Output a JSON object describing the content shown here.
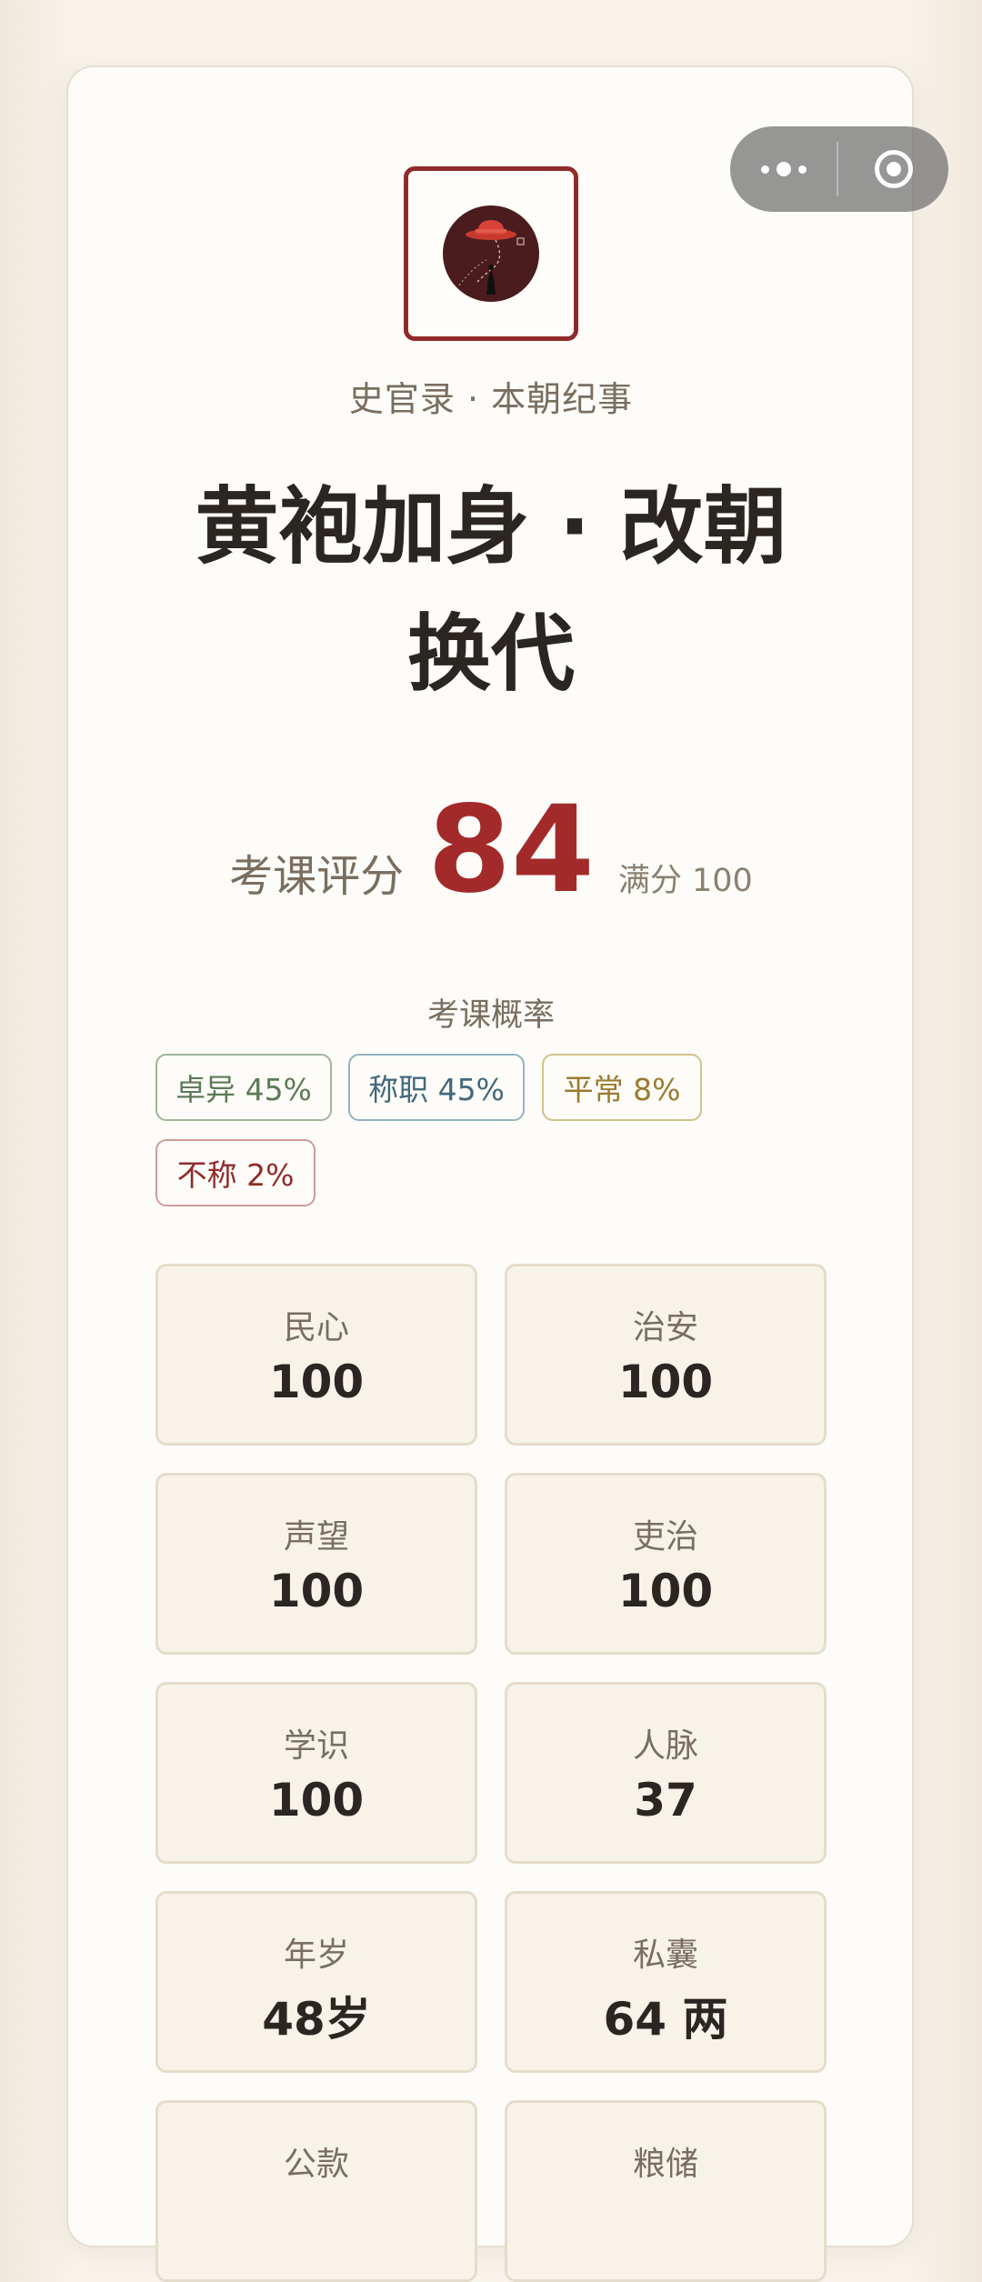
{
  "header": {
    "subtitle": "史官录 · 本朝纪事",
    "title": "黄袍加身 · 改朝换代"
  },
  "score": {
    "label": "考课评分",
    "value": "84",
    "max_label": "满分 100"
  },
  "probability": {
    "title": "考课概率",
    "tags": [
      {
        "label": "卓异 45%"
      },
      {
        "label": "称职 45%"
      },
      {
        "label": "平常 8%"
      },
      {
        "label": "不称 2%"
      }
    ]
  },
  "stats": [
    {
      "label": "民心",
      "value": "100"
    },
    {
      "label": "治安",
      "value": "100"
    },
    {
      "label": "声望",
      "value": "100"
    },
    {
      "label": "吏治",
      "value": "100"
    },
    {
      "label": "学识",
      "value": "100"
    },
    {
      "label": "人脉",
      "value": "37"
    },
    {
      "label": "年岁",
      "value": "48岁"
    },
    {
      "label": "私囊",
      "value": "64 两"
    },
    {
      "label": "公款",
      "value": ""
    },
    {
      "label": "粮储",
      "value": ""
    }
  ],
  "colors": {
    "accent_red": "#a32a2a",
    "logo_border": "#8f2b2b",
    "excellent": "#5c7a58",
    "competent": "#43697b",
    "ordinary": "#9a7c2f",
    "unfit": "#8f2b2b"
  },
  "icons": {
    "capsule_more": "more-dots-icon",
    "capsule_close": "close-target-icon",
    "logo": "hat-emblem-logo"
  }
}
